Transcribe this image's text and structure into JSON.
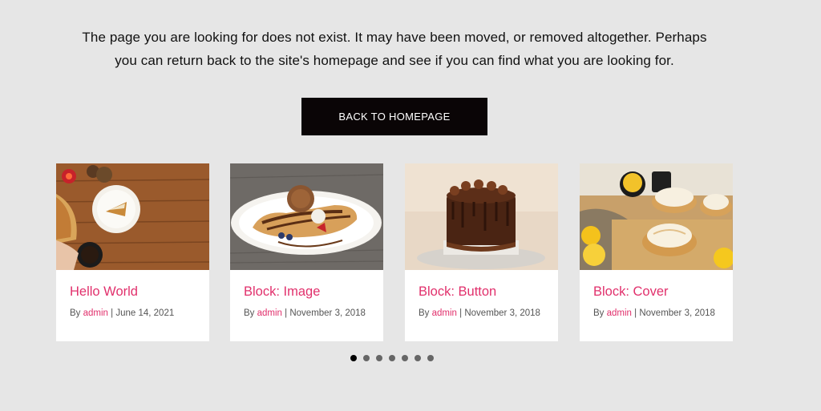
{
  "message": {
    "line1": "The page you are looking for does not exist. It may have been moved, or removed altogether. Perhaps",
    "line2": "you can return back to the site's homepage and see if you can find what you are looking for."
  },
  "back_button": {
    "label": "BACK TO HOMEPAGE"
  },
  "posts": [
    {
      "title": "Hello World",
      "by": "By ",
      "author": "admin",
      "sep": " | ",
      "date": "June 14, 2021"
    },
    {
      "title": "Block: Image",
      "by": "By ",
      "author": "admin",
      "sep": " | ",
      "date": "November 3, 2018"
    },
    {
      "title": "Block: Button",
      "by": "By ",
      "author": "admin",
      "sep": " | ",
      "date": "November 3, 2018"
    },
    {
      "title": "Block: Cover",
      "by": "By ",
      "author": "admin",
      "sep": " | ",
      "date": "November 3, 2018"
    }
  ],
  "carousel": {
    "total_dots": 7,
    "active_dot": 1
  },
  "colors": {
    "accent": "#e1306c",
    "button_bg": "#0a0506",
    "page_bg": "#e6e6e6"
  }
}
